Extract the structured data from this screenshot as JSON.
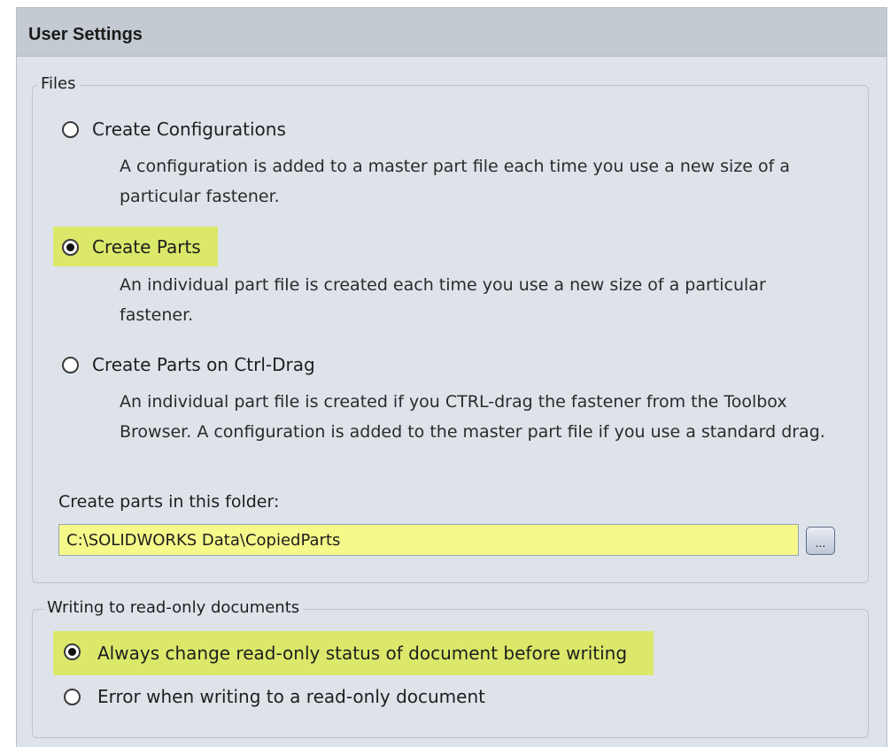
{
  "header": {
    "title": "User Settings"
  },
  "files_group": {
    "legend": "Files",
    "options": [
      {
        "label": "Create Configurations",
        "checked": false,
        "description": "A configuration is added to a master part file each time you use a new size of a particular fastener."
      },
      {
        "label": "Create Parts",
        "checked": true,
        "highlighted": true,
        "description": "An individual part file is created each time you use a new size of a particular fastener."
      },
      {
        "label": "Create Parts on Ctrl-Drag",
        "checked": false,
        "description": "An individual part file is created if you CTRL-drag the fastener from the Toolbox Browser. A configuration is added to the master part file if you use a standard drag."
      }
    ],
    "folder_label": "Create parts in this folder:",
    "folder_value": "C:\\SOLIDWORKS Data\\CopiedParts",
    "browse_label": "..."
  },
  "readonly_group": {
    "legend": "Writing to read-only documents",
    "options": [
      {
        "label": "Always change read-only status of document before writing",
        "checked": true,
        "highlighted": true
      },
      {
        "label": "Error when writing to a read-only document",
        "checked": false
      }
    ]
  },
  "colors": {
    "highlight": "#dbe86a",
    "input_highlight": "#f4f98a",
    "arrow": "#e02418",
    "panel": "#dee3ea",
    "header": "#c4cad2"
  }
}
